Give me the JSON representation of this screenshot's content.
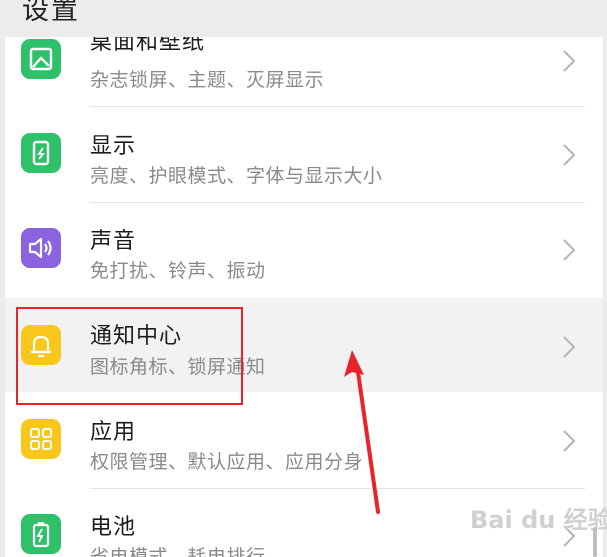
{
  "header": {
    "title": "设置"
  },
  "items": [
    {
      "id": "wallpaper",
      "title": "桌面和壁纸",
      "subtitle": "杂志锁屏、主题、灭屏显示",
      "icon": "wallpaper-icon",
      "color": "#2fc06a"
    },
    {
      "id": "display",
      "title": "显示",
      "subtitle": "亮度、护眼模式、字体与显示大小",
      "icon": "display-icon",
      "color": "#2fc06a"
    },
    {
      "id": "sound",
      "title": "声音",
      "subtitle": "免打扰、铃声、振动",
      "icon": "speaker-icon",
      "color": "#8a63e0"
    },
    {
      "id": "notification",
      "title": "通知中心",
      "subtitle": "图标角标、锁屏通知",
      "icon": "bell-icon",
      "color": "#f9c61b"
    },
    {
      "id": "apps",
      "title": "应用",
      "subtitle": "权限管理、默认应用、应用分身",
      "icon": "apps-grid-icon",
      "color": "#f9c61b"
    },
    {
      "id": "battery",
      "title": "电池",
      "subtitle": "省电模式、耗电排行",
      "icon": "battery-icon",
      "color": "#2fc06a"
    }
  ],
  "annotation": {
    "highlight_color": "#e8232c"
  },
  "watermark": {
    "text": "Bai du 经验"
  }
}
